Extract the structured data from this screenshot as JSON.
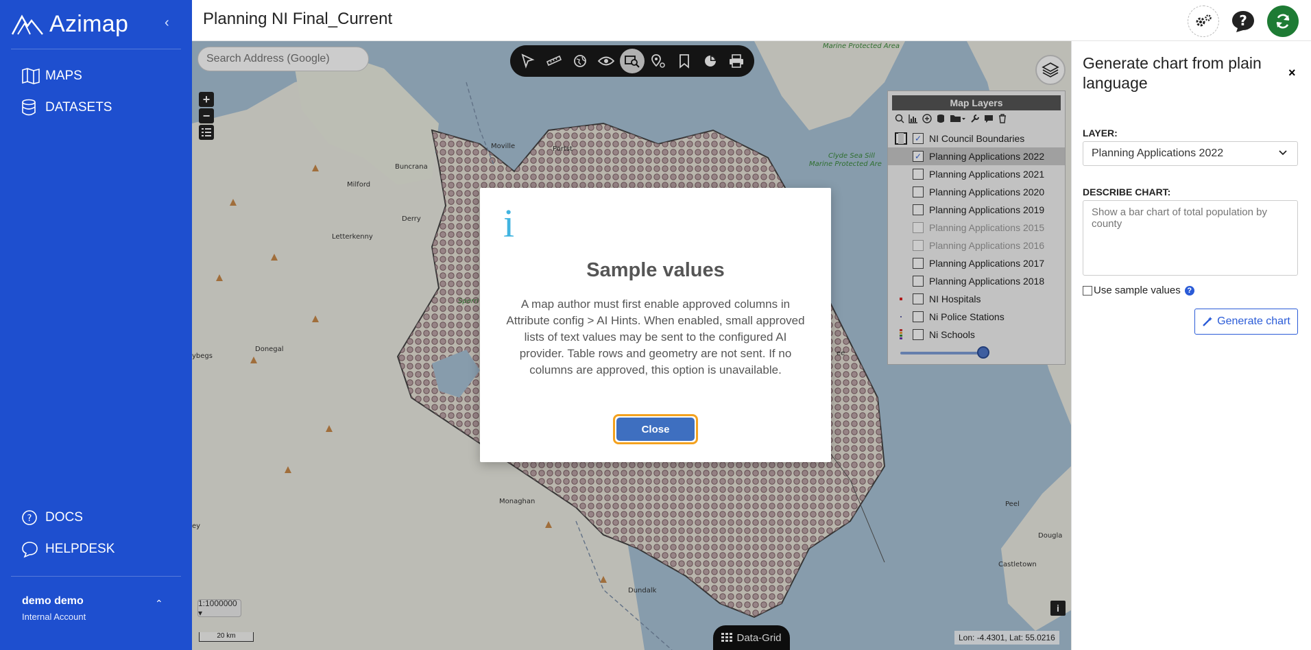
{
  "app": {
    "brand": "Azimap",
    "collapse": "‹"
  },
  "sidebar": {
    "items": [
      {
        "label": "MAPS"
      },
      {
        "label": "DATASETS"
      }
    ],
    "bottom_items": [
      {
        "label": "DOCS"
      },
      {
        "label": "HELPDESK"
      }
    ],
    "user": {
      "name": "demo demo",
      "role": "Internal Account",
      "caret": "⌃"
    }
  },
  "header": {
    "title": "Planning NI Final_Current"
  },
  "map": {
    "search_placeholder": "Search Address (Google)",
    "zoom_in": "+",
    "zoom_out": "−",
    "scale": "1:1000000 ▾",
    "scalebar": "20 km",
    "datagrid": "Data-Grid",
    "coords": "Lon: -4.4301, Lat: 55.0216",
    "info": "i",
    "labels": {
      "marine1": "Marine Protected Area",
      "clyde": "Clyde Sea Sill",
      "marine2": "Marine Protected Are",
      "moville": "Moville",
      "portstewart": "Portst",
      "buncrana": "Buncrana",
      "milford": "Milford",
      "derry": "Derry",
      "letterkenny": "Letterkenny",
      "sperrin": "Sperri",
      "donegal": "Donegal",
      "ybegs": "ybegs",
      "ey": "ey",
      "monaghan": "Monaghan",
      "dundalk": "Dundalk",
      "peel": "Peel",
      "dougla": "Dougla",
      "castletown": "Castletown",
      "ee": "ee"
    }
  },
  "layers": {
    "title": "Map Layers",
    "items": [
      {
        "name": "NI Council Boundaries",
        "checked": true,
        "disabled": false
      },
      {
        "name": "Planning Applications 2022",
        "checked": true,
        "disabled": false,
        "selected": true
      },
      {
        "name": "Planning Applications 2021",
        "checked": false,
        "disabled": false
      },
      {
        "name": "Planning Applications 2020",
        "checked": false,
        "disabled": false
      },
      {
        "name": "Planning Applications 2019",
        "checked": false,
        "disabled": false
      },
      {
        "name": "Planning Applications 2015",
        "checked": false,
        "disabled": true
      },
      {
        "name": "Planning Applications 2016",
        "checked": false,
        "disabled": true
      },
      {
        "name": "Planning Applications 2017",
        "checked": false,
        "disabled": false
      },
      {
        "name": "Planning Applications 2018",
        "checked": false,
        "disabled": false
      },
      {
        "name": "NI Hospitals",
        "checked": false,
        "disabled": false
      },
      {
        "name": "Ni Police Stations",
        "checked": false,
        "disabled": false
      },
      {
        "name": "Ni Schools",
        "checked": false,
        "disabled": false
      }
    ],
    "check_mark": "✓"
  },
  "panel": {
    "title": "Generate chart from plain language",
    "close": "×",
    "layer_label": "LAYER:",
    "layer_value": "Planning Applications 2022",
    "describe_label": "DESCRIBE CHART:",
    "describe_placeholder": "Show a bar chart of total population by county",
    "sample_label": "Use sample values",
    "help": "?",
    "generate": "Generate chart"
  },
  "modal": {
    "icon": "i",
    "title": "Sample values",
    "body": "A map author must first enable approved columns in Attribute config > AI Hints. When enabled, small approved lists of text values may be sent to the configured AI provider. Table rows and geometry are not sent. If no columns are approved, this option is unavailable.",
    "close": "Close"
  },
  "colors": {
    "sidebar": "#1e4fcf",
    "accent": "#2a5bd7",
    "focus": "#f4a21f",
    "info_icon": "#41b4e0"
  }
}
